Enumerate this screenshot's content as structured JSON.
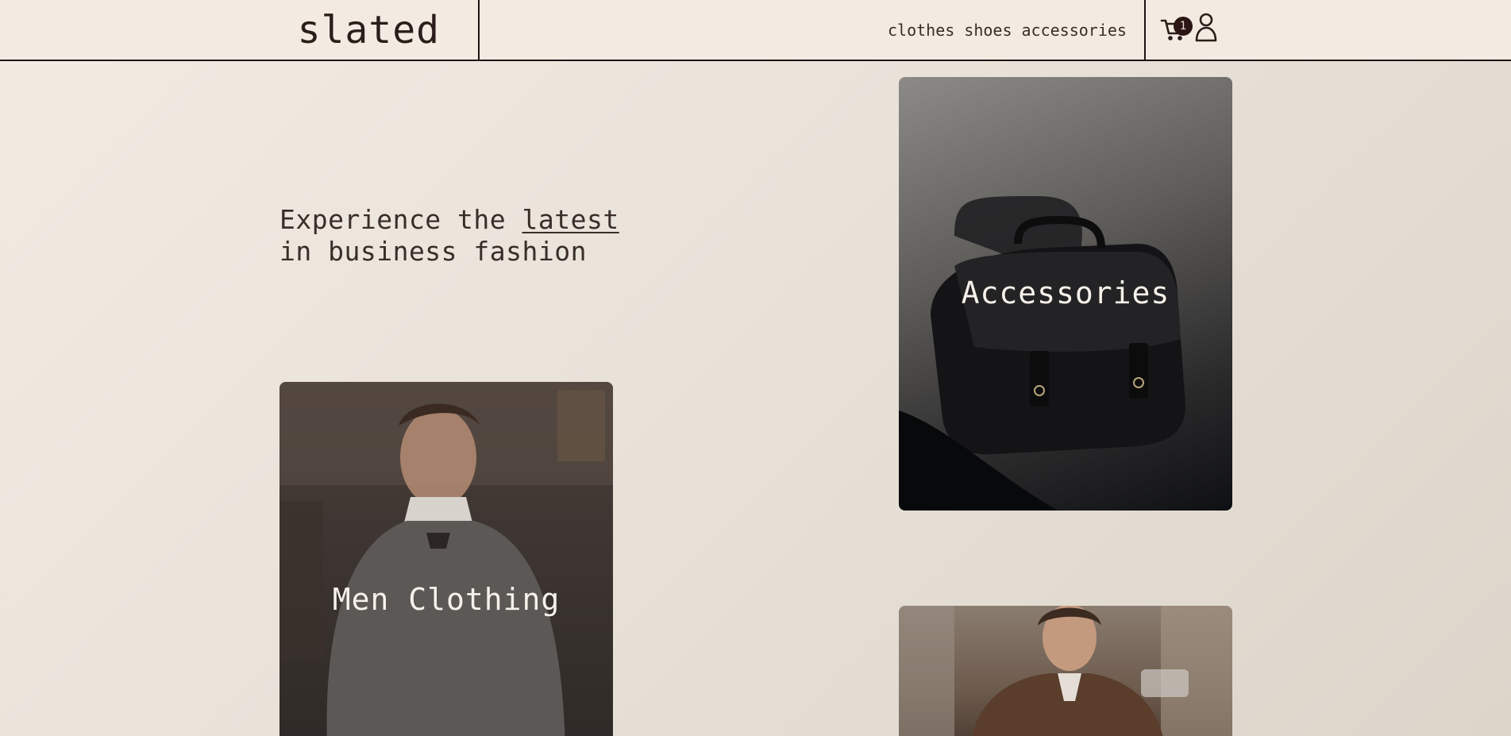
{
  "header": {
    "logo": "slated",
    "nav": [
      "clothes",
      "shoes",
      "accessories"
    ],
    "cart_count": "1"
  },
  "hero": {
    "line1_pre": "Experience the ",
    "line1_highlight": "latest",
    "line2": "in business fashion"
  },
  "cards": {
    "accessories": "Accessories",
    "men": "Men Clothing"
  },
  "colors": {
    "background": "#ebe3da",
    "ink": "#2b1d1a",
    "badge": "#2b1614"
  },
  "icons": [
    "cart-icon",
    "user-icon"
  ]
}
